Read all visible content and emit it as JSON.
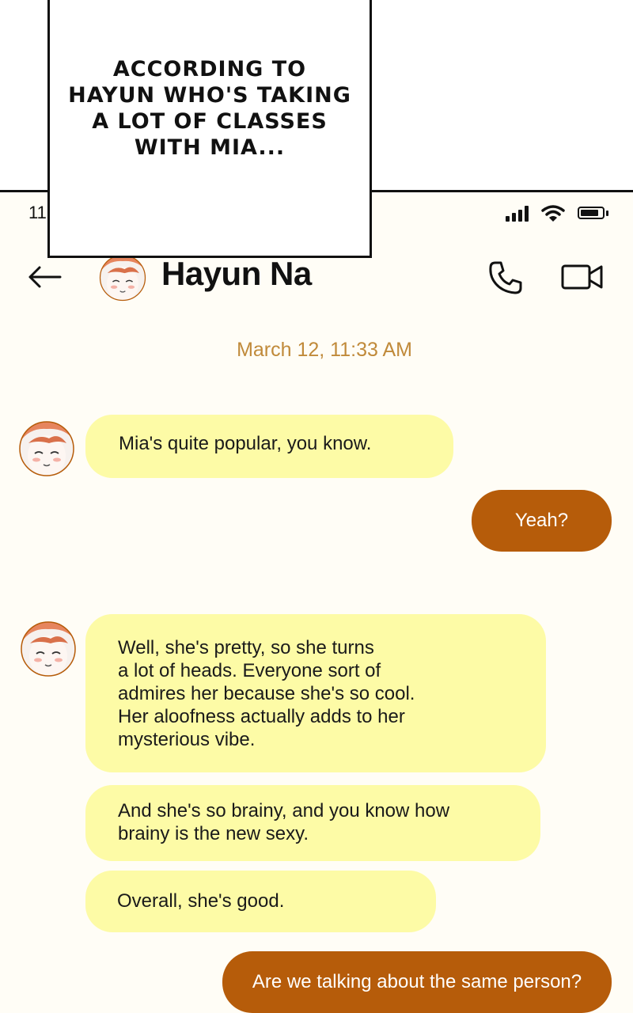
{
  "caption": "ACCORDING TO\nHAYUN WHO'S TAKING\nA LOT OF CLASSES\nWITH MIA...",
  "status_bar": {
    "time": "11",
    "icons": [
      "signal-icon",
      "wifi-icon",
      "battery-icon"
    ]
  },
  "header": {
    "contact_name": "Hayun Na",
    "icons": [
      "back-arrow-icon",
      "avatar",
      "phone-icon",
      "video-call-icon"
    ]
  },
  "chat": {
    "date": "March 12, 11:33 AM",
    "messages": [
      {
        "from": "Hayun Na",
        "text": "Mia's quite popular, you know."
      },
      {
        "from": "me",
        "text": "Yeah?"
      },
      {
        "from": "Hayun Na",
        "text": "Well, she's pretty, so she turns\na lot of heads. Everyone sort of\nadmires her because she's so cool.\nHer aloofness actually adds to her\nmysterious vibe."
      },
      {
        "from": "Hayun Na",
        "text": "And she's so brainy, and you know how\nbrainy is the new sexy."
      },
      {
        "from": "Hayun Na",
        "text": "Overall, she's good."
      },
      {
        "from": "me",
        "text": "Are we talking about the same person?"
      }
    ]
  },
  "colors": {
    "incoming_bubble": "#fdfba6",
    "outgoing_bubble": "#b65c0a",
    "date_text": "#c08a3a",
    "chat_background": "#fffdf6"
  }
}
